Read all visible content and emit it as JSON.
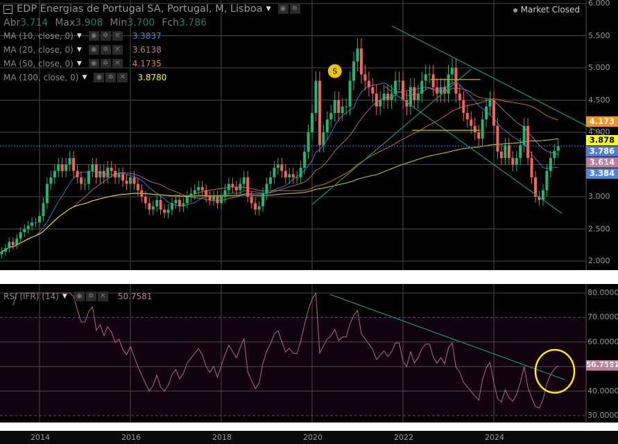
{
  "header": {
    "symbol_title": "EDP Energias de Portugal SA, Portugal, M, Lisboa",
    "ohlc": [
      {
        "label": "Abr",
        "value": "3.714"
      },
      {
        "label": "Max",
        "value": "3.908"
      },
      {
        "label": "Min",
        "value": "3.700"
      },
      {
        "label": "Fch",
        "value": "3.786"
      }
    ],
    "market_status": "Market Closed"
  },
  "indicators": [
    {
      "label": "MA (10, close, 0)",
      "value": "3.3837",
      "color": "#4a86e8",
      "period": 10
    },
    {
      "label": "MA (20, close, 0)",
      "value": "3.6138",
      "color": "#c07aa0",
      "period": 20
    },
    {
      "label": "MA (50, close, 0)",
      "value": "4.1735",
      "color": "#e8870e",
      "period": 50
    },
    {
      "label": "MA (100, close, 0)",
      "value": "3.8780",
      "color": "#ffff00",
      "period": 100
    }
  ],
  "rsi": {
    "label": "RSI (IFR) (14)",
    "value": "50.7581",
    "color": "#b06890"
  },
  "price_tags": [
    {
      "text": "4.173",
      "price": 4.173,
      "bg": "#f7931a",
      "fg": "#ffffff"
    },
    {
      "text": "3.878",
      "price": 3.878,
      "bg": "#ffff00",
      "fg": "#000000"
    },
    {
      "text": "3.786",
      "price": 3.786,
      "bg": "#4a7fe0",
      "fg": "#ffffff"
    },
    {
      "text": "3.614",
      "price": 3.614,
      "bg": "#c07aa0",
      "fg": "#ffffff"
    },
    {
      "text": "3.384",
      "price": 3.384,
      "bg": "#4a86e8",
      "fg": "#ffffff"
    }
  ],
  "event_marker": {
    "text": "S",
    "year": 2020.5,
    "price": 4.95
  },
  "chart_data": {
    "type": "candlestick",
    "interval": "monthly",
    "start": "2013-03",
    "price_axis": {
      "min": 2.0,
      "max": 6.0,
      "ticks": [
        "6.000",
        "5.500",
        "5.000",
        "4.500",
        "4.000",
        "3.500",
        "3.000",
        "2.500",
        "2.000"
      ]
    },
    "rsi_axis": {
      "min": 30,
      "max": 80,
      "ticks": [
        "80.0000",
        "70.0000",
        "60.0000",
        "50.0000",
        "40.0000",
        "30.0000"
      ]
    },
    "x_ticks": [
      "2014",
      "2016",
      "2018",
      "2020",
      "2022",
      "2024"
    ],
    "colors": {
      "up": "#22b573",
      "down": "#f0645c",
      "trend": "#1f8a70",
      "level": "#b5b800"
    },
    "closes": [
      2.15,
      2.2,
      2.3,
      2.25,
      2.35,
      2.45,
      2.5,
      2.55,
      2.6,
      2.6,
      2.7,
      2.9,
      3.2,
      3.3,
      3.4,
      3.5,
      3.4,
      3.5,
      3.6,
      3.4,
      3.3,
      3.2,
      3.2,
      3.4,
      3.5,
      3.3,
      3.4,
      3.3,
      3.45,
      3.4,
      3.3,
      3.35,
      3.25,
      3.2,
      3.3,
      3.2,
      3.1,
      3.0,
      2.9,
      2.8,
      2.85,
      2.95,
      2.8,
      2.75,
      2.8,
      2.9,
      2.95,
      2.85,
      2.9,
      3.0,
      3.05,
      3.1,
      3.15,
      3.1,
      3.0,
      2.95,
      3.0,
      2.9,
      3.0,
      3.1,
      3.2,
      3.15,
      3.1,
      3.2,
      3.3,
      3.0,
      2.9,
      2.8,
      2.85,
      3.05,
      3.2,
      3.3,
      3.45,
      3.5,
      3.4,
      3.3,
      3.35,
      3.3,
      3.3,
      3.45,
      3.7,
      4.0,
      4.3,
      4.8,
      3.8,
      4.0,
      4.2,
      4.3,
      4.5,
      4.3,
      4.4,
      4.4,
      4.8,
      5.1,
      5.3,
      4.9,
      4.8,
      4.7,
      4.6,
      4.4,
      4.5,
      4.6,
      4.5,
      4.6,
      4.8,
      4.8,
      4.5,
      4.4,
      4.7,
      4.5,
      4.6,
      4.8,
      4.9,
      4.9,
      4.7,
      4.6,
      4.7,
      4.6,
      4.9,
      5.0,
      4.6,
      4.5,
      4.3,
      4.2,
      4.1,
      4.0,
      3.9,
      4.2,
      4.4,
      4.5,
      4.1,
      3.7,
      3.6,
      3.8,
      3.6,
      3.5,
      3.6,
      3.8,
      4.1,
      3.6,
      3.3,
      3.0,
      2.95,
      3.1,
      3.4,
      3.6,
      3.714,
      3.786
    ],
    "drawings": [
      {
        "kind": "trend",
        "from": [
          2021.76,
          5.65
        ],
        "to": [
          2026.73,
          3.85
        ]
      },
      {
        "kind": "trend",
        "from": [
          2021.6,
          4.71
        ],
        "to": [
          2025.5,
          2.74
        ]
      },
      {
        "kind": "trend",
        "from": [
          2020.0,
          2.88
        ],
        "to": [
          2023.5,
          4.98
        ]
      },
      {
        "kind": "level",
        "from": [
          2022.2,
          4.03
        ],
        "to": [
          2023.7,
          4.03
        ]
      },
      {
        "kind": "level",
        "from": [
          2022.6,
          4.82
        ],
        "to": [
          2023.7,
          4.82
        ]
      }
    ],
    "rsi_drawings": [
      {
        "kind": "trend",
        "from": [
          2020.4,
          79.4
        ],
        "to": [
          2025.57,
          44.6
        ]
      }
    ]
  }
}
